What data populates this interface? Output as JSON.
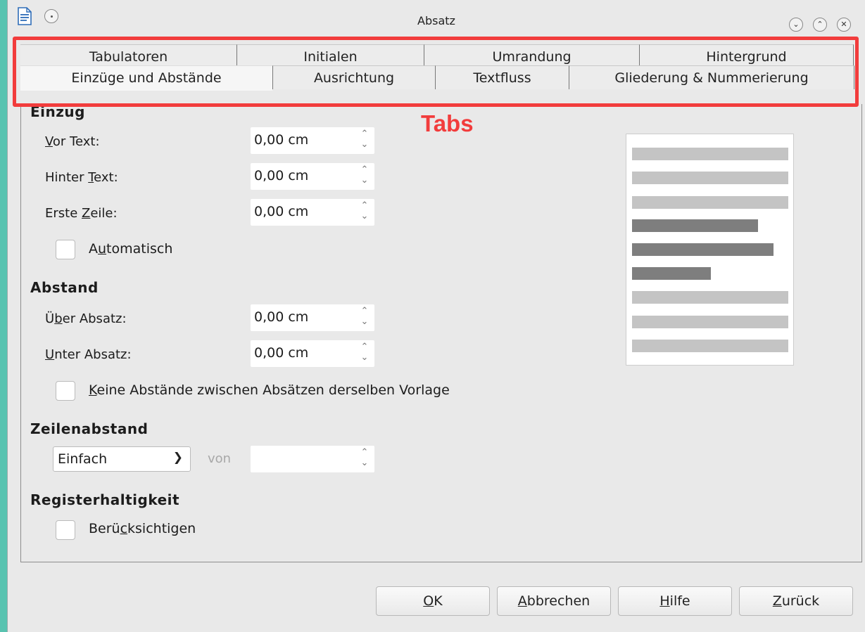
{
  "window": {
    "title": "Absatz",
    "controls": [
      "chevron-down-icon",
      "chevron-up-icon",
      "close-icon"
    ]
  },
  "tabs": {
    "back_row": [
      "Tabulatoren",
      "Initialen",
      "Umrandung",
      "Hintergrund"
    ],
    "front_row": [
      "Einzüge und Abstände",
      "Ausrichtung",
      "Textfluss",
      "Gliederung & Nummerierung"
    ],
    "active": "Einzüge und Abstände"
  },
  "annotation": {
    "label": "Tabs",
    "color": "#f23c3c"
  },
  "einzug": {
    "title": "Einzug",
    "vor_text": {
      "label_pre": "",
      "label_u": "V",
      "label_post": "or Text:",
      "value": "0,00 cm"
    },
    "hinter_text": {
      "label_pre": "Hinter ",
      "label_u": "T",
      "label_post": "ext:",
      "value": "0,00 cm"
    },
    "erste_zeile": {
      "label_pre": "Erste ",
      "label_u": "Z",
      "label_post": "eile:",
      "value": "0,00 cm"
    },
    "automatisch": {
      "label_pre": "A",
      "label_u": "u",
      "label_post": "tomatisch",
      "checked": false
    }
  },
  "abstand": {
    "title": "Abstand",
    "ueber": {
      "label_pre": "Ü",
      "label_u": "b",
      "label_post": "er Absatz:",
      "value": "0,00 cm"
    },
    "unter": {
      "label_pre": "",
      "label_u": "U",
      "label_post": "nter Absatz:",
      "value": "0,00 cm"
    },
    "keine": {
      "label_pre": "",
      "label_u": "K",
      "label_post": "eine Abstände zwischen Absätzen derselben Vorlage",
      "checked": false
    }
  },
  "zeilenabstand": {
    "title": "Zeilenabstand",
    "selected": "Einfach",
    "von_label": "von",
    "von_value": ""
  },
  "register": {
    "title": "Registerhaltigkeit",
    "beruecksichtigen": {
      "label_pre": "Berü",
      "label_u": "c",
      "label_post": "ksichtigen",
      "checked": false
    }
  },
  "preview": {
    "colors": {
      "light": "#c4c4c4",
      "dark": "#7e7e7e"
    }
  },
  "buttons": {
    "ok": {
      "label_pre": "",
      "label_u": "O",
      "label_post": "K"
    },
    "cancel": {
      "label_pre": "",
      "label_u": "A",
      "label_post": "bbrechen"
    },
    "help": {
      "label_pre": "",
      "label_u": "H",
      "label_post": "ilfe"
    },
    "back": {
      "label_pre": "",
      "label_u": "Z",
      "label_post": "urück"
    }
  }
}
